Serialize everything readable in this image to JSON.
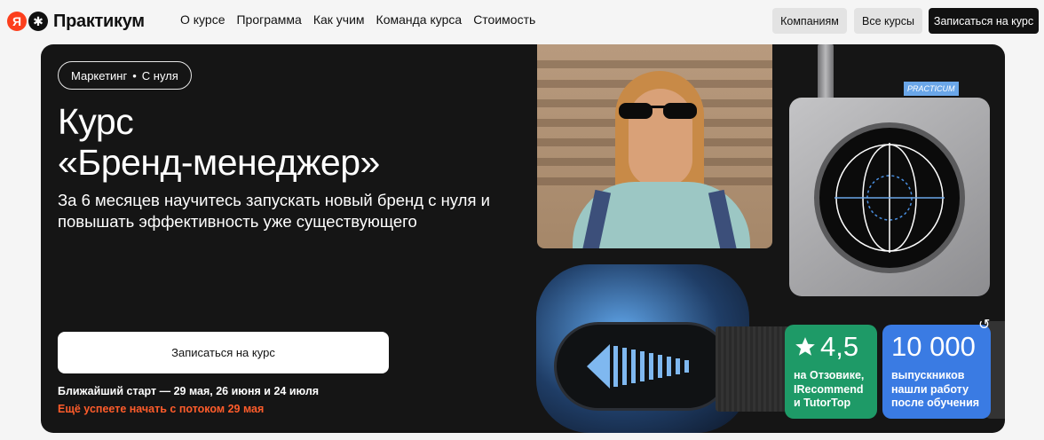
{
  "header": {
    "logo_text": "Практикум",
    "nav": [
      "О курсе",
      "Программа",
      "Как учим",
      "Команда курса",
      "Стоимость"
    ],
    "companies_label": "Компаниям",
    "all_courses_label": "Все курсы",
    "signup_label": "Записаться на курс"
  },
  "hero": {
    "chip_category": "Маркетинг",
    "chip_level": "С нуля",
    "title_line1": "Курс",
    "title_line2": "«Бренд-менеджер»",
    "subtitle": "За 6 месяцев научитесь запускать новый бренд с нуля и повышать эффективность уже существующего",
    "cta_label": "Записаться на курс",
    "nearest_start": "Ближайший старт — 29 мая, 26 июня и 24 июля",
    "stream_note": "Ещё успеете начать с потоком 29 мая",
    "device_tag": "PRACTICUM"
  },
  "stats": {
    "rating_value": "4,5",
    "rating_caption": "на Отзовике, IRecommend и TutorTop",
    "graduates_value": "10 000",
    "graduates_caption": "выпускников нашли работу после обучения"
  },
  "colors": {
    "accent_orange": "#ff5c2b",
    "rating_green": "#1e9a67",
    "graduates_blue": "#3a7be3",
    "hero_bg": "#151515"
  }
}
